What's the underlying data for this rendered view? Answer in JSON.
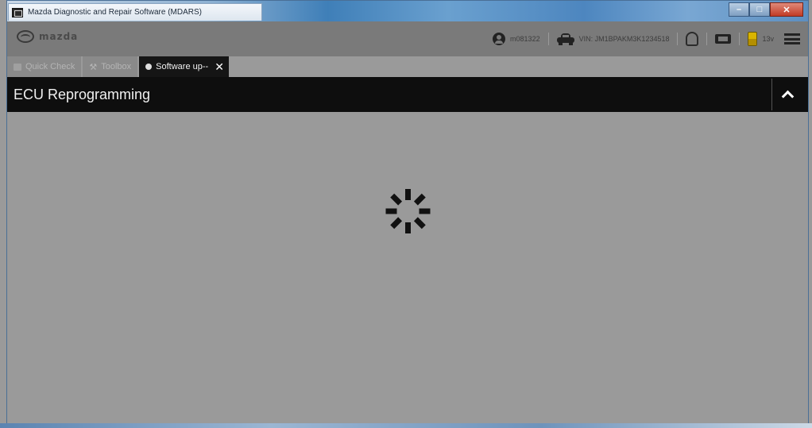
{
  "window": {
    "title": "Mazda Diagnostic and Repair Software (MDARS)",
    "controls": {
      "minimize": "–",
      "maximize": "□",
      "close": "✕"
    }
  },
  "header": {
    "logo_text": "mazda",
    "user_id": "m081322",
    "vin_label": "VIN: JM1BPAKM3K1234518",
    "voltage": "13v"
  },
  "tabs": [
    {
      "label": "Quick Check",
      "active": false,
      "icon": "clipboard-icon"
    },
    {
      "label": "Toolbox",
      "active": false,
      "icon": "tools-icon"
    },
    {
      "label": "Software up--",
      "active": true,
      "icon": "dot-icon",
      "closable": true
    }
  ],
  "section": {
    "title": "ECU Reprogramming",
    "collapse_icon": "chevron-up-icon"
  },
  "content": {
    "state": "loading",
    "spinner_icon": "loading-spinner-icon"
  }
}
